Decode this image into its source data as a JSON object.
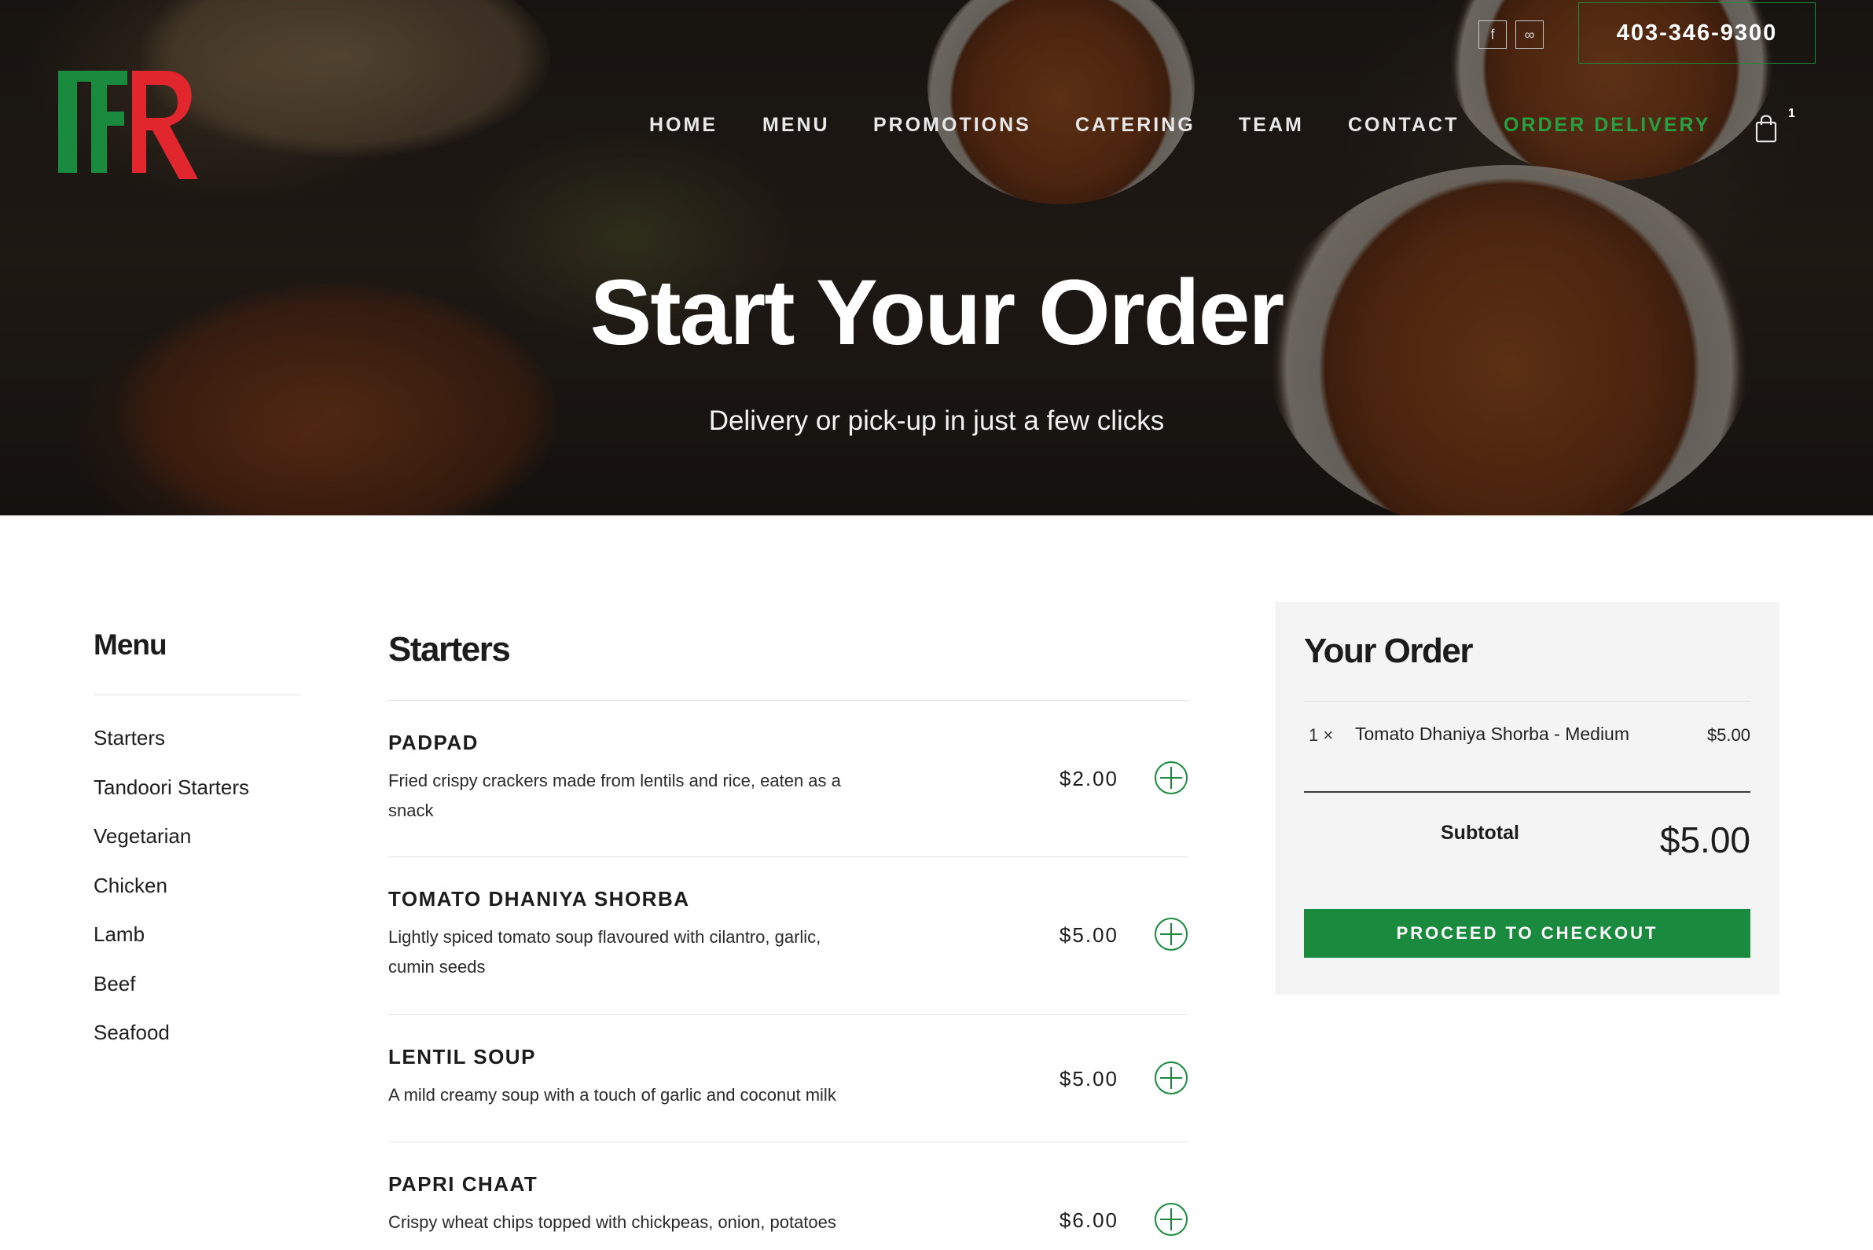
{
  "brand": {
    "green": "#1a8b3e",
    "red": "#e1262d"
  },
  "header": {
    "phone": "403-346-9300",
    "social": [
      {
        "icon": "facebook-icon",
        "glyph": "f"
      },
      {
        "icon": "tripadvisor-icon",
        "glyph": "∞"
      }
    ],
    "cart_count": "1"
  },
  "nav": [
    {
      "label": "HOME"
    },
    {
      "label": "MENU"
    },
    {
      "label": "PROMOTIONS"
    },
    {
      "label": "CATERING"
    },
    {
      "label": "TEAM"
    },
    {
      "label": "CONTACT"
    },
    {
      "label": "ORDER DELIVERY",
      "active": true
    }
  ],
  "hero": {
    "title": "Start Your Order",
    "subtitle": "Delivery or pick-up in just a few clicks"
  },
  "sidebar": {
    "title": "Menu",
    "items": [
      {
        "label": "Starters"
      },
      {
        "label": "Tandoori Starters"
      },
      {
        "label": "Vegetarian"
      },
      {
        "label": "Chicken"
      },
      {
        "label": "Lamb"
      },
      {
        "label": "Beef"
      },
      {
        "label": "Seafood"
      }
    ]
  },
  "section": {
    "title": "Starters",
    "items": [
      {
        "name": "PADPAD",
        "description": "Fried crispy crackers made from lentils and rice, eaten as a snack",
        "price": "$2.00"
      },
      {
        "name": "TOMATO DHANIYA SHORBA",
        "description": "Lightly spiced tomato soup flavoured with cilantro, garlic, cumin seeds",
        "price": "$5.00"
      },
      {
        "name": "LENTIL SOUP",
        "description": "A mild creamy soup with a touch of garlic and coconut milk",
        "price": "$5.00"
      },
      {
        "name": "PAPRI CHAAT",
        "description": "Crispy wheat chips topped with chickpeas, onion, potatoes",
        "price": "$6.00"
      }
    ]
  },
  "order": {
    "title": "Your Order",
    "lines": [
      {
        "qty": "1 ×",
        "item": "Tomato Dhaniya Shorba - Medium",
        "amount": "$5.00"
      }
    ],
    "subtotal_label": "Subtotal",
    "subtotal_value": "$5.00",
    "checkout_label": "PROCEED TO CHECKOUT"
  }
}
